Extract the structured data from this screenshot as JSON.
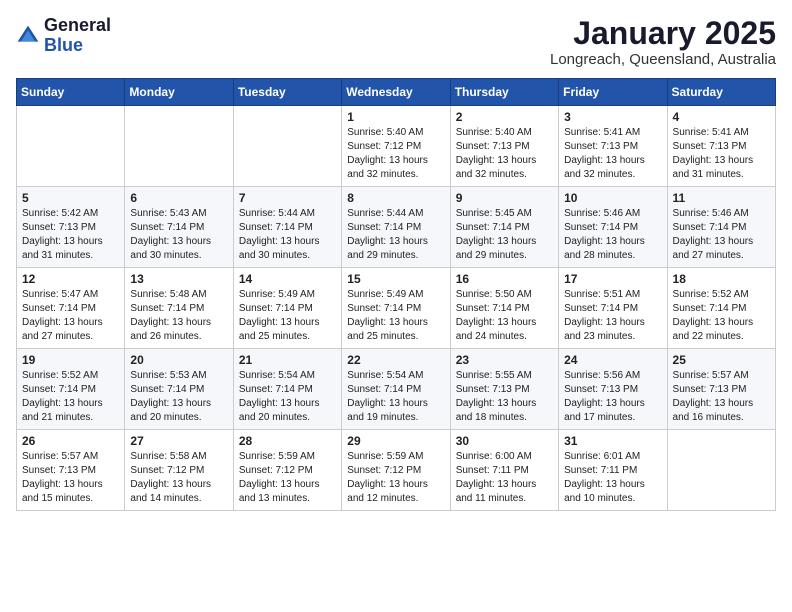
{
  "header": {
    "logo_general": "General",
    "logo_blue": "Blue",
    "month_title": "January 2025",
    "location": "Longreach, Queensland, Australia"
  },
  "weekdays": [
    "Sunday",
    "Monday",
    "Tuesday",
    "Wednesday",
    "Thursday",
    "Friday",
    "Saturday"
  ],
  "weeks": [
    [
      {
        "day": "",
        "sunrise": "",
        "sunset": "",
        "daylight": ""
      },
      {
        "day": "",
        "sunrise": "",
        "sunset": "",
        "daylight": ""
      },
      {
        "day": "",
        "sunrise": "",
        "sunset": "",
        "daylight": ""
      },
      {
        "day": "1",
        "sunrise": "Sunrise: 5:40 AM",
        "sunset": "Sunset: 7:12 PM",
        "daylight": "Daylight: 13 hours and 32 minutes."
      },
      {
        "day": "2",
        "sunrise": "Sunrise: 5:40 AM",
        "sunset": "Sunset: 7:13 PM",
        "daylight": "Daylight: 13 hours and 32 minutes."
      },
      {
        "day": "3",
        "sunrise": "Sunrise: 5:41 AM",
        "sunset": "Sunset: 7:13 PM",
        "daylight": "Daylight: 13 hours and 32 minutes."
      },
      {
        "day": "4",
        "sunrise": "Sunrise: 5:41 AM",
        "sunset": "Sunset: 7:13 PM",
        "daylight": "Daylight: 13 hours and 31 minutes."
      }
    ],
    [
      {
        "day": "5",
        "sunrise": "Sunrise: 5:42 AM",
        "sunset": "Sunset: 7:13 PM",
        "daylight": "Daylight: 13 hours and 31 minutes."
      },
      {
        "day": "6",
        "sunrise": "Sunrise: 5:43 AM",
        "sunset": "Sunset: 7:14 PM",
        "daylight": "Daylight: 13 hours and 30 minutes."
      },
      {
        "day": "7",
        "sunrise": "Sunrise: 5:44 AM",
        "sunset": "Sunset: 7:14 PM",
        "daylight": "Daylight: 13 hours and 30 minutes."
      },
      {
        "day": "8",
        "sunrise": "Sunrise: 5:44 AM",
        "sunset": "Sunset: 7:14 PM",
        "daylight": "Daylight: 13 hours and 29 minutes."
      },
      {
        "day": "9",
        "sunrise": "Sunrise: 5:45 AM",
        "sunset": "Sunset: 7:14 PM",
        "daylight": "Daylight: 13 hours and 29 minutes."
      },
      {
        "day": "10",
        "sunrise": "Sunrise: 5:46 AM",
        "sunset": "Sunset: 7:14 PM",
        "daylight": "Daylight: 13 hours and 28 minutes."
      },
      {
        "day": "11",
        "sunrise": "Sunrise: 5:46 AM",
        "sunset": "Sunset: 7:14 PM",
        "daylight": "Daylight: 13 hours and 27 minutes."
      }
    ],
    [
      {
        "day": "12",
        "sunrise": "Sunrise: 5:47 AM",
        "sunset": "Sunset: 7:14 PM",
        "daylight": "Daylight: 13 hours and 27 minutes."
      },
      {
        "day": "13",
        "sunrise": "Sunrise: 5:48 AM",
        "sunset": "Sunset: 7:14 PM",
        "daylight": "Daylight: 13 hours and 26 minutes."
      },
      {
        "day": "14",
        "sunrise": "Sunrise: 5:49 AM",
        "sunset": "Sunset: 7:14 PM",
        "daylight": "Daylight: 13 hours and 25 minutes."
      },
      {
        "day": "15",
        "sunrise": "Sunrise: 5:49 AM",
        "sunset": "Sunset: 7:14 PM",
        "daylight": "Daylight: 13 hours and 25 minutes."
      },
      {
        "day": "16",
        "sunrise": "Sunrise: 5:50 AM",
        "sunset": "Sunset: 7:14 PM",
        "daylight": "Daylight: 13 hours and 24 minutes."
      },
      {
        "day": "17",
        "sunrise": "Sunrise: 5:51 AM",
        "sunset": "Sunset: 7:14 PM",
        "daylight": "Daylight: 13 hours and 23 minutes."
      },
      {
        "day": "18",
        "sunrise": "Sunrise: 5:52 AM",
        "sunset": "Sunset: 7:14 PM",
        "daylight": "Daylight: 13 hours and 22 minutes."
      }
    ],
    [
      {
        "day": "19",
        "sunrise": "Sunrise: 5:52 AM",
        "sunset": "Sunset: 7:14 PM",
        "daylight": "Daylight: 13 hours and 21 minutes."
      },
      {
        "day": "20",
        "sunrise": "Sunrise: 5:53 AM",
        "sunset": "Sunset: 7:14 PM",
        "daylight": "Daylight: 13 hours and 20 minutes."
      },
      {
        "day": "21",
        "sunrise": "Sunrise: 5:54 AM",
        "sunset": "Sunset: 7:14 PM",
        "daylight": "Daylight: 13 hours and 20 minutes."
      },
      {
        "day": "22",
        "sunrise": "Sunrise: 5:54 AM",
        "sunset": "Sunset: 7:14 PM",
        "daylight": "Daylight: 13 hours and 19 minutes."
      },
      {
        "day": "23",
        "sunrise": "Sunrise: 5:55 AM",
        "sunset": "Sunset: 7:13 PM",
        "daylight": "Daylight: 13 hours and 18 minutes."
      },
      {
        "day": "24",
        "sunrise": "Sunrise: 5:56 AM",
        "sunset": "Sunset: 7:13 PM",
        "daylight": "Daylight: 13 hours and 17 minutes."
      },
      {
        "day": "25",
        "sunrise": "Sunrise: 5:57 AM",
        "sunset": "Sunset: 7:13 PM",
        "daylight": "Daylight: 13 hours and 16 minutes."
      }
    ],
    [
      {
        "day": "26",
        "sunrise": "Sunrise: 5:57 AM",
        "sunset": "Sunset: 7:13 PM",
        "daylight": "Daylight: 13 hours and 15 minutes."
      },
      {
        "day": "27",
        "sunrise": "Sunrise: 5:58 AM",
        "sunset": "Sunset: 7:12 PM",
        "daylight": "Daylight: 13 hours and 14 minutes."
      },
      {
        "day": "28",
        "sunrise": "Sunrise: 5:59 AM",
        "sunset": "Sunset: 7:12 PM",
        "daylight": "Daylight: 13 hours and 13 minutes."
      },
      {
        "day": "29",
        "sunrise": "Sunrise: 5:59 AM",
        "sunset": "Sunset: 7:12 PM",
        "daylight": "Daylight: 13 hours and 12 minutes."
      },
      {
        "day": "30",
        "sunrise": "Sunrise: 6:00 AM",
        "sunset": "Sunset: 7:11 PM",
        "daylight": "Daylight: 13 hours and 11 minutes."
      },
      {
        "day": "31",
        "sunrise": "Sunrise: 6:01 AM",
        "sunset": "Sunset: 7:11 PM",
        "daylight": "Daylight: 13 hours and 10 minutes."
      },
      {
        "day": "",
        "sunrise": "",
        "sunset": "",
        "daylight": ""
      }
    ]
  ]
}
